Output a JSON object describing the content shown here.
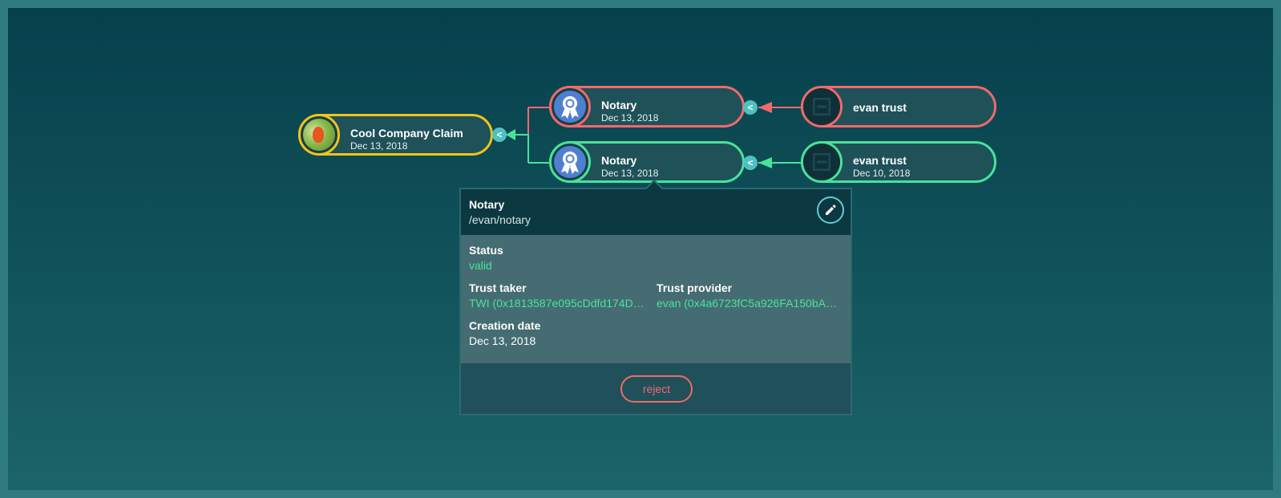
{
  "graph": {
    "root": {
      "title": "Cool Company Claim",
      "date": "Dec 13, 2018",
      "status_color": "#f0c419"
    },
    "notary_top": {
      "title": "Notary",
      "date": "Dec 13, 2018",
      "status_color": "#f06a6a"
    },
    "notary_bottom": {
      "title": "Notary",
      "date": "Dec 13, 2018",
      "status_color": "#48e39a"
    },
    "issuer_top": {
      "title": "evan trust",
      "date": "",
      "status_color": "#f06a6a"
    },
    "issuer_bottom": {
      "title": "evan trust",
      "date": "Dec 10, 2018",
      "status_color": "#48e39a"
    },
    "collapse_glyph": "<"
  },
  "popup": {
    "title": "Notary",
    "path": "/evan/notary",
    "status_label": "Status",
    "status_value": "valid",
    "trust_taker_label": "Trust taker",
    "trust_taker_value": "TWI (0x1813587e095cDdfd174Dd…",
    "trust_provider_label": "Trust provider",
    "trust_provider_value": "evan (0x4a6723fC5a926FA150bAe…",
    "creation_date_label": "Creation date",
    "creation_date_value": "Dec 13, 2018",
    "reject_label": "reject"
  },
  "colors": {
    "valid": "#48e39a",
    "rejected": "#f06a6a",
    "pending": "#f0c419",
    "accent": "#4fc1c1"
  }
}
